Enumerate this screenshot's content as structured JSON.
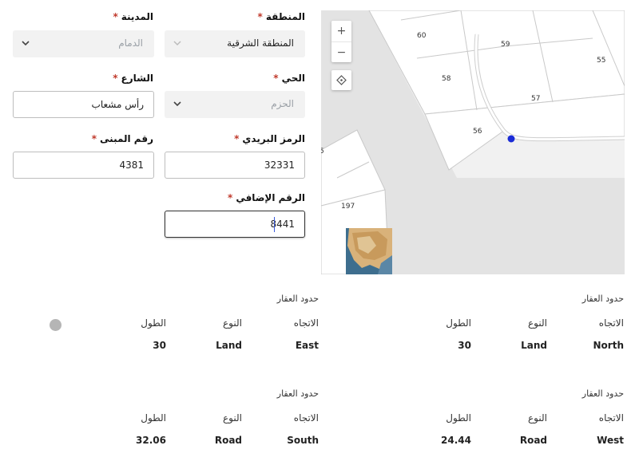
{
  "form": {
    "region": {
      "label": "المنطقة",
      "value": "المنطقة الشرقية"
    },
    "city": {
      "label": "المدينة",
      "value": "الدمام"
    },
    "district": {
      "label": "الحي",
      "value": "الحزم"
    },
    "street": {
      "label": "الشارع",
      "value": "رأس مشعاب"
    },
    "postal_code": {
      "label": "الرمز البريدي",
      "value": "32331"
    },
    "building_number": {
      "label": "رقم المبنى",
      "value": "4381"
    },
    "additional_number": {
      "label": "الرقم الإضافي",
      "value": "8441"
    },
    "required_mark": "*"
  },
  "map": {
    "zoom_in": "+",
    "zoom_out": "−",
    "parcels": [
      "60",
      "59",
      "55",
      "58",
      "57",
      "56",
      "197",
      "5"
    ]
  },
  "boundaries": {
    "section_title": "حدود العقار",
    "col_direction": "الاتجاه",
    "col_type": "النوع",
    "col_length": "الطول",
    "north": {
      "direction": "North",
      "type": "Land",
      "length": "30"
    },
    "east": {
      "direction": "East",
      "type": "Land",
      "length": "30"
    },
    "west": {
      "direction": "West",
      "type": "Road",
      "length": "24.44"
    },
    "south": {
      "direction": "South",
      "type": "Road",
      "length": "32.06"
    }
  }
}
